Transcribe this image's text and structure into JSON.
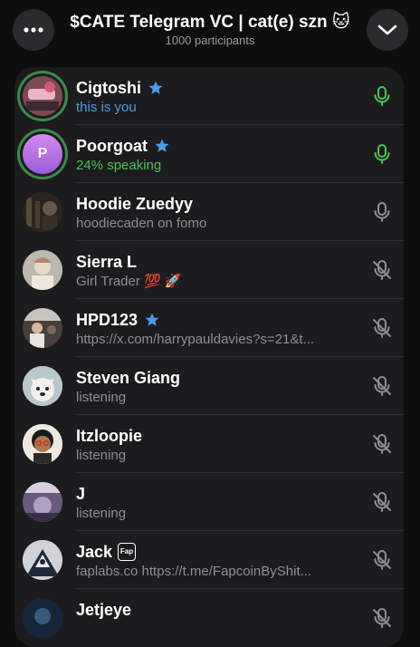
{
  "header": {
    "title": "$CATE Telegram VC | cat(e) szn 🐱",
    "subtitle": "1000 participants",
    "menu_icon": "more-icon",
    "collapse_icon": "chevron-down-icon"
  },
  "colors": {
    "accent_blue": "#4a9be8",
    "speaking_green": "#4cc35a",
    "muted_gray": "#8e8e93"
  },
  "participants": [
    {
      "name": "Cigtoshi",
      "status": "this is you",
      "verified": true,
      "mic": "active"
    },
    {
      "name": "Poorgoat",
      "status": "24% speaking",
      "verified": true,
      "mic": "active",
      "avatar_letter": "P"
    },
    {
      "name": "Hoodie Zuedyy",
      "status": "hoodiecaden on fomo",
      "verified": false,
      "mic": "on"
    },
    {
      "name": "Sierra L",
      "status": "Girl Trader 💯 🚀",
      "verified": false,
      "mic": "muted"
    },
    {
      "name": "HPD123",
      "status": "https://x.com/harrypauldavies?s=21&t...",
      "verified": true,
      "mic": "muted"
    },
    {
      "name": "Steven Giang",
      "status": "listening",
      "verified": false,
      "mic": "muted"
    },
    {
      "name": "Itzloopie",
      "status": "listening",
      "verified": false,
      "mic": "muted"
    },
    {
      "name": "J",
      "status": "listening",
      "verified": false,
      "mic": "muted"
    },
    {
      "name": "Jack",
      "status": "faplabs.co https://t.me/FapcoinByShit...",
      "verified": false,
      "mic": "muted",
      "badge": "Fap"
    },
    {
      "name": "Jetjeye",
      "status": "",
      "verified": false,
      "mic": "muted"
    }
  ]
}
